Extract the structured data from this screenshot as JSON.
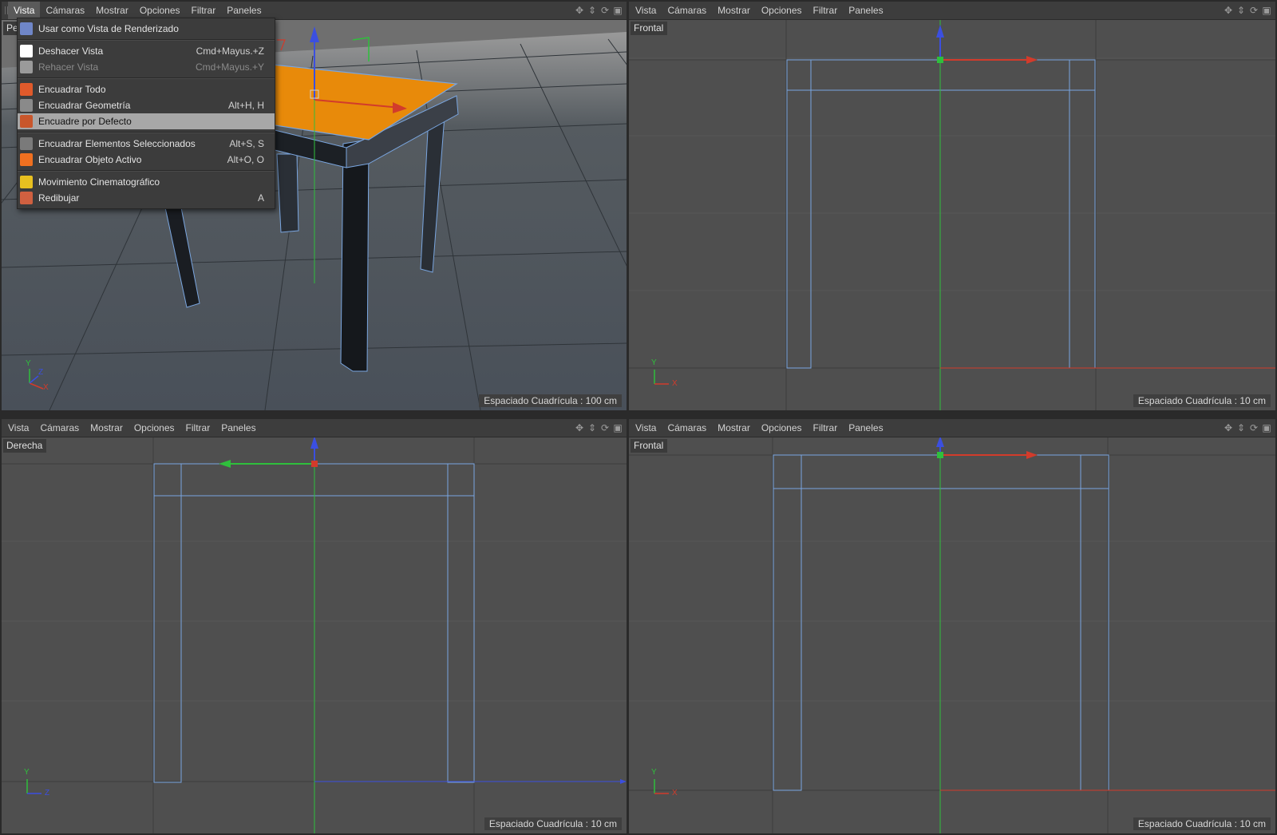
{
  "viewports": {
    "perspective": {
      "label": "Pe",
      "menu": [
        "Vista",
        "Cámaras",
        "Mostrar",
        "Opciones",
        "Filtrar",
        "Paneles"
      ],
      "grid_spacing": "Espaciado Cuadrícula : 100 cm"
    },
    "front_top": {
      "label": "Frontal",
      "menu": [
        "Vista",
        "Cámaras",
        "Mostrar",
        "Opciones",
        "Filtrar",
        "Paneles"
      ],
      "grid_spacing": "Espaciado Cuadrícula : 10 cm"
    },
    "right": {
      "label": "Derecha",
      "menu": [
        "Vista",
        "Cámaras",
        "Mostrar",
        "Opciones",
        "Filtrar",
        "Paneles"
      ],
      "grid_spacing": "Espaciado Cuadrícula : 10 cm"
    },
    "front_bottom": {
      "label": "Frontal",
      "menu": [
        "Vista",
        "Cámaras",
        "Mostrar",
        "Opciones",
        "Filtrar",
        "Paneles"
      ],
      "grid_spacing": "Espaciado Cuadrícula : 10 cm"
    }
  },
  "nav_icons": [
    "move-icon",
    "zoom-icon",
    "rotate-icon",
    "maximize-icon"
  ],
  "axes": {
    "x": "X",
    "y": "Y",
    "z": "Z"
  },
  "dropdown": {
    "items": [
      {
        "label": "Usar como Vista de Renderizado",
        "shortcut": "",
        "icon": "render-view-icon",
        "state": "normal"
      },
      {
        "sep": true
      },
      {
        "label": "Deshacer Vista",
        "shortcut": "Cmd+Mayus.+Z",
        "icon": "undo-view-icon",
        "state": "normal"
      },
      {
        "label": "Rehacer Vista",
        "shortcut": "Cmd+Mayus.+Y",
        "icon": "redo-view-icon",
        "state": "disabled"
      },
      {
        "sep": true
      },
      {
        "label": "Encuadrar Todo",
        "shortcut": "",
        "icon": "frame-all-icon",
        "state": "normal"
      },
      {
        "label": "Encuadrar Geometría",
        "shortcut": "Alt+H, H",
        "icon": "frame-geometry-icon",
        "state": "normal"
      },
      {
        "label": "Encuadre por Defecto",
        "shortcut": "",
        "icon": "frame-default-icon",
        "state": "highlight"
      },
      {
        "sep": true
      },
      {
        "label": "Encuadrar Elementos Seleccionados",
        "shortcut": "Alt+S, S",
        "icon": "frame-selected-icon",
        "state": "normal"
      },
      {
        "label": "Encuadrar Objeto Activo",
        "shortcut": "Alt+O, O",
        "icon": "frame-active-icon",
        "state": "normal"
      },
      {
        "sep": true
      },
      {
        "label": "Movimiento Cinematográfico",
        "shortcut": "",
        "icon": "cinematic-icon",
        "state": "normal"
      },
      {
        "label": "Redibujar",
        "shortcut": "A",
        "icon": "redraw-icon",
        "state": "normal"
      }
    ]
  },
  "colors": {
    "viewport_bg": "#4f4f4f",
    "grid_minor": "#555555",
    "grid_major": "#3a3a3a",
    "wire": "#7aa6e0",
    "axis_x": "#d23b2b",
    "axis_y": "#2fbf3c",
    "axis_z": "#3b4fe0",
    "table_top": "#e88a0a"
  }
}
